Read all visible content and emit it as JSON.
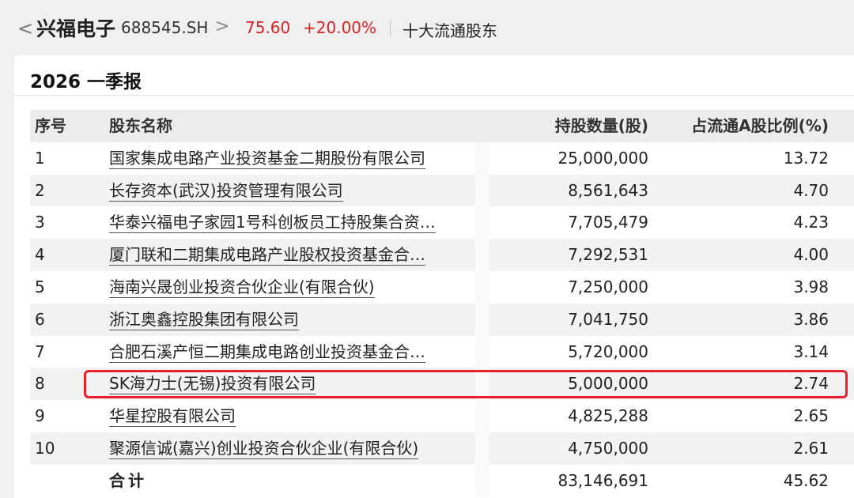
{
  "header": {
    "back_glyph": "<",
    "stock_name": "兴福电子",
    "stock_code": "688545.SH",
    "chevron_glyph": ">",
    "price": "75.60",
    "change": "+20.00%",
    "page_title": "十大流通股东",
    "price_color": "#e02020"
  },
  "report": {
    "title": "2026 一季报"
  },
  "table": {
    "columns": [
      "序号",
      "股东名称",
      "持股数量(股)",
      "占流通A股比例(%)"
    ],
    "rows": [
      {
        "no": "1",
        "name": "国家集成电路产业投资基金二期股份有限公司",
        "shares": "25,000,000",
        "pct": "13.72"
      },
      {
        "no": "2",
        "name": "长存资本(武汉)投资管理有限公司",
        "shares": "8,561,643",
        "pct": "4.70"
      },
      {
        "no": "3",
        "name": "华泰兴福电子家园1号科创板员工持股集合资…",
        "shares": "7,705,479",
        "pct": "4.23"
      },
      {
        "no": "4",
        "name": "厦门联和二期集成电路产业股权投资基金合…",
        "shares": "7,292,531",
        "pct": "4.00"
      },
      {
        "no": "5",
        "name": "海南兴晟创业投资合伙企业(有限合伙)",
        "shares": "7,250,000",
        "pct": "3.98"
      },
      {
        "no": "6",
        "name": "浙江奥鑫控股集团有限公司",
        "shares": "7,041,750",
        "pct": "3.86"
      },
      {
        "no": "7",
        "name": "合肥石溪产恒二期集成电路创业投资基金合…",
        "shares": "5,720,000",
        "pct": "3.14"
      },
      {
        "no": "8",
        "name": "SK海力士(无锡)投资有限公司",
        "shares": "5,000,000",
        "pct": "2.74"
      },
      {
        "no": "9",
        "name": "华星控股有限公司",
        "shares": "4,825,288",
        "pct": "2.65"
      },
      {
        "no": "10",
        "name": "聚源信诚(嘉兴)创业投资合伙企业(有限合伙)",
        "shares": "4,750,000",
        "pct": "2.61"
      }
    ],
    "total": {
      "label": "合计",
      "shares": "83,146,691",
      "pct": "45.62"
    },
    "highlight_color": "#e8202a"
  }
}
